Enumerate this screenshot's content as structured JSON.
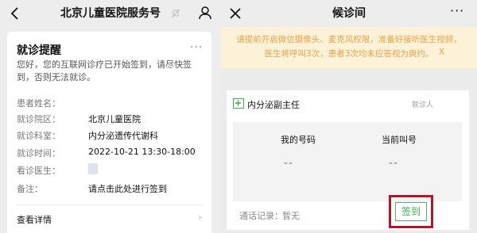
{
  "left": {
    "header": {
      "title": "北京儿童医院服务号"
    },
    "card": {
      "title": "就诊提醒",
      "more": "···",
      "message": "您好，您的互联网诊疗已开始签到，请尽快签到，否则无法就诊。",
      "rows": [
        {
          "label": "患者姓名：",
          "value": ""
        },
        {
          "label": "就诊院区：",
          "value": "北京儿童医院"
        },
        {
          "label": "就诊科室：",
          "value": "内分泌遗传代谢科"
        },
        {
          "label": "就诊时间：",
          "value": "2022-10-21 13:30-18:00"
        },
        {
          "label": "看诊医生：",
          "value": ""
        },
        {
          "label": "备注：",
          "value": "请点击此处进行签到"
        }
      ],
      "view_details": "查看详情",
      "chevron": "›"
    }
  },
  "right": {
    "header": {
      "title": "候诊间",
      "more": "···"
    },
    "notice": {
      "line1": "请提前开启微信摄像头、麦克风权限，准备好接听医生视频，",
      "line2": "医生将呼叫3次，患者3次均未应答视为爽约。",
      "close": "X"
    },
    "card": {
      "dept": "内分泌副主任",
      "patient_tag": "就诊人",
      "my_number_label": "我的号码",
      "current_number_label": "当前叫号",
      "my_number_value": "--",
      "current_number_value": "--",
      "call_record_label": "通话记录：",
      "call_record_value": "暂无",
      "signin": "签到"
    }
  },
  "colors": {
    "accent_green": "#3cae55",
    "notice_text": "#e8a24a",
    "notice_bg": "#fdf2d8",
    "highlight_red": "#b0172c"
  }
}
